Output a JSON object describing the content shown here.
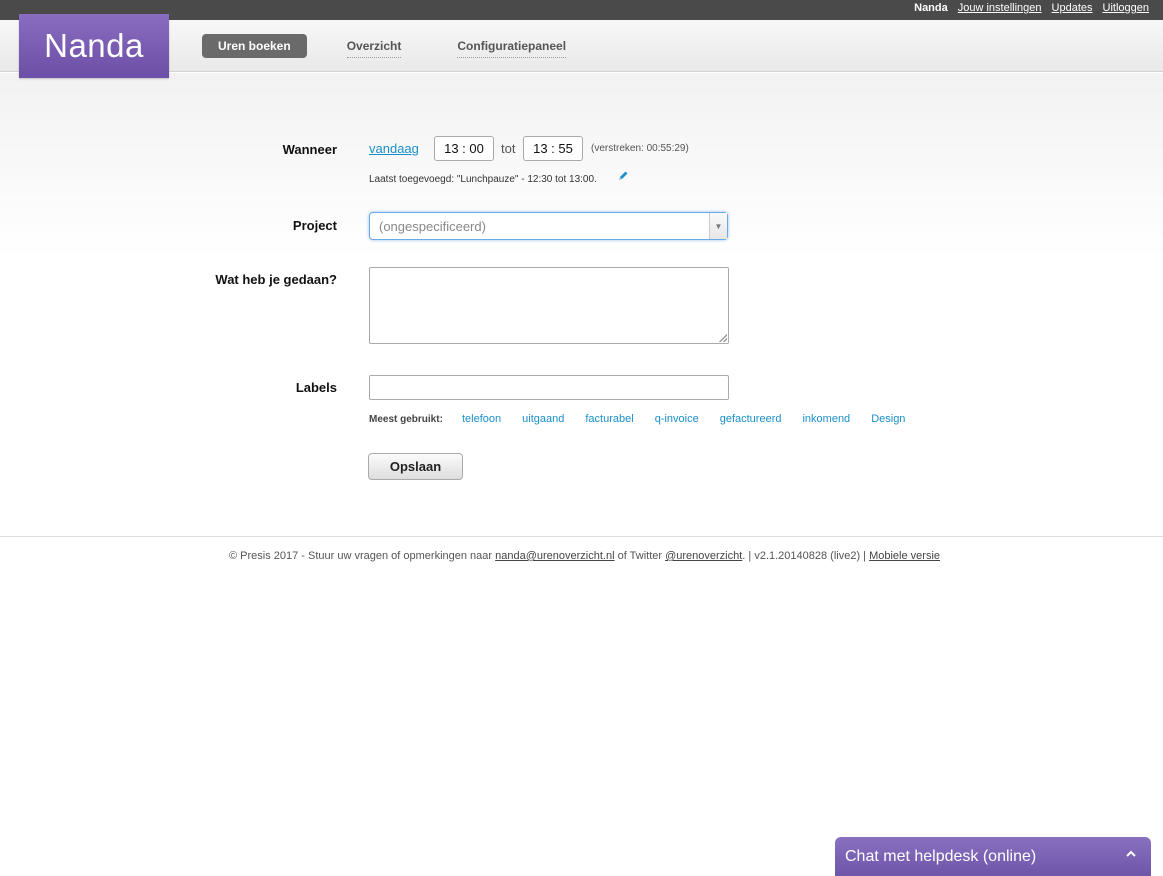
{
  "topbar": {
    "user": "Nanda",
    "links": [
      "Jouw instellingen",
      "Updates",
      "Uitloggen"
    ]
  },
  "header": {
    "logo": "Nanda",
    "tabs": [
      {
        "label": "Uren boeken",
        "active": true
      },
      {
        "label": "Overzicht",
        "active": false
      },
      {
        "label": "Configuratiepaneel",
        "active": false
      }
    ]
  },
  "form": {
    "when_label": "Wanneer",
    "when_link": "vandaag",
    "start_time": "13 : 00",
    "to_text": "tot",
    "end_time": "13 : 55",
    "elapsed": "(verstreken: 00:55:29)",
    "last_added": "Laatst toegevoegd: \"Lunchpauze\" - 12:30 tot 13:00.",
    "project_label": "Project",
    "project_value": "(ongespecificeerd)",
    "what_label": "Wat heb je gedaan?",
    "labels_label": "Labels",
    "most_used_label": "Meest gebruikt:",
    "tags": [
      "telefoon",
      "uitgaand",
      "facturabel",
      "q-invoice",
      "gefactureerd",
      "inkomend",
      "Design"
    ],
    "save_label": "Opslaan"
  },
  "footer": {
    "prefix": "© Presis 2017 - Stuur uw vragen of opmerkingen naar ",
    "email": "nanda@urenoverzicht.nl",
    "middle": " of Twitter ",
    "twitter": "@urenoverzicht",
    "version": ".   |  v2.1.20140828 (live2)  |  ",
    "mobile": "Mobiele versie"
  },
  "chat": {
    "label": "Chat met helpdesk (online)",
    "icon": "chevron-up-icon"
  },
  "colors": {
    "brand": "#7b5fb5",
    "link": "#1a8fc9",
    "topbar": "#4a4a4a"
  }
}
